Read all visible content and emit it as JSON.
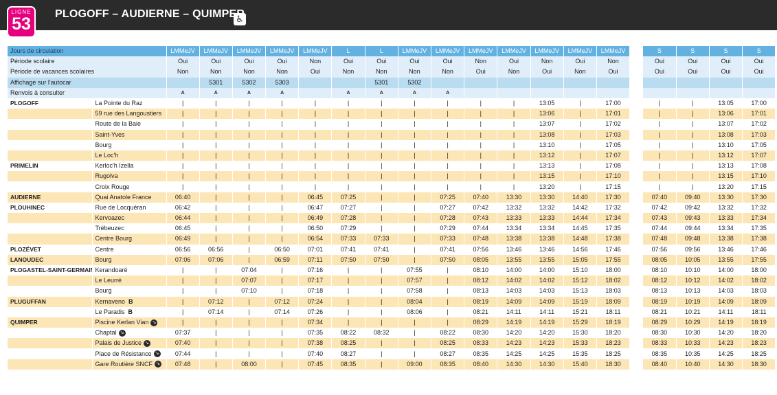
{
  "header": {
    "badge_label": "LIGNE",
    "badge_number": "53",
    "title": "PLOGOFF – AUDIERNE – QUIMPER",
    "accessibility_icon": "wheelchair-icon"
  },
  "colors": {
    "accent": "#e6007e",
    "header_blue": "#62b1e1",
    "light_blue": "#dfeef8",
    "mid_blue": "#b9dcf1",
    "row_alt": "#fde6b6",
    "topbar": "#2b2b2b"
  },
  "left": {
    "header_rows": [
      {
        "label": "Jours de circulation",
        "cells": [
          "LMMeJV",
          "LMMeJV",
          "LMMeJV",
          "LMMeJV",
          "LMMeJV",
          "L",
          "L",
          "LMMeJV",
          "LMMeJV",
          "LMMeJV",
          "LMMeJV",
          "LMMeJV",
          "LMMeJV",
          "LMMeJV"
        ]
      },
      {
        "label": "Période scolaire",
        "cells": [
          "Oui",
          "Oui",
          "Oui",
          "Oui",
          "Non",
          "Oui",
          "Oui",
          "Oui",
          "Oui",
          "Non",
          "Oui",
          "Non",
          "Oui",
          "Non"
        ]
      },
      {
        "label": "Période de vacances scolaires",
        "cells": [
          "Non",
          "Non",
          "Non",
          "Non",
          "Oui",
          "Non",
          "Non",
          "Non",
          "Non",
          "Oui",
          "Non",
          "Oui",
          "Non",
          "Oui"
        ]
      },
      {
        "label": "Affichage sur l'autocar",
        "cells": [
          "",
          "5301",
          "5302",
          "5303",
          "",
          "",
          "5301",
          "5302",
          "",
          "",
          "",
          "",
          "",
          ""
        ]
      },
      {
        "label": "Renvois à consulter",
        "cells": [
          "A",
          "A",
          "A",
          "A",
          "",
          "A",
          "A",
          "A",
          "A",
          "",
          "",
          "",
          "",
          ""
        ]
      }
    ],
    "rows": [
      {
        "town": "PLOGOFF",
        "stop": "La Pointe du Raz",
        "dir": false,
        "b": false,
        "t": [
          "|",
          "|",
          "|",
          "|",
          "|",
          "|",
          "|",
          "|",
          "|",
          "|",
          "|",
          "13:05",
          "|",
          "17:00"
        ]
      },
      {
        "town": "",
        "stop": "59 rue des Langoustiers",
        "dir": false,
        "b": false,
        "t": [
          "|",
          "|",
          "|",
          "|",
          "|",
          "|",
          "|",
          "|",
          "|",
          "|",
          "|",
          "13:06",
          "|",
          "17:01"
        ]
      },
      {
        "town": "",
        "stop": "Route de la Baie",
        "dir": false,
        "b": false,
        "t": [
          "|",
          "|",
          "|",
          "|",
          "|",
          "|",
          "|",
          "|",
          "|",
          "|",
          "|",
          "13:07",
          "|",
          "17:02"
        ]
      },
      {
        "town": "",
        "stop": "Saint-Yves",
        "dir": false,
        "b": false,
        "t": [
          "|",
          "|",
          "|",
          "|",
          "|",
          "|",
          "|",
          "|",
          "|",
          "|",
          "|",
          "13:08",
          "|",
          "17:03"
        ]
      },
      {
        "town": "",
        "stop": "Bourg",
        "dir": false,
        "b": false,
        "t": [
          "|",
          "|",
          "|",
          "|",
          "|",
          "|",
          "|",
          "|",
          "|",
          "|",
          "|",
          "13:10",
          "|",
          "17:05"
        ]
      },
      {
        "town": "",
        "stop": "Le Loc'h",
        "dir": false,
        "b": false,
        "t": [
          "|",
          "|",
          "|",
          "|",
          "|",
          "|",
          "|",
          "|",
          "|",
          "|",
          "|",
          "13:12",
          "|",
          "17:07"
        ]
      },
      {
        "town": "PRIMELIN",
        "stop": "Kerloc'h Izella",
        "dir": false,
        "b": false,
        "t": [
          "|",
          "|",
          "|",
          "|",
          "|",
          "|",
          "|",
          "|",
          "|",
          "|",
          "|",
          "13:13",
          "|",
          "17:08"
        ]
      },
      {
        "town": "",
        "stop": "Rugolva",
        "dir": false,
        "b": false,
        "t": [
          "|",
          "|",
          "|",
          "|",
          "|",
          "|",
          "|",
          "|",
          "|",
          "|",
          "|",
          "13:15",
          "|",
          "17:10"
        ]
      },
      {
        "town": "",
        "stop": "Croix Rouge",
        "dir": false,
        "b": false,
        "t": [
          "|",
          "|",
          "|",
          "|",
          "|",
          "|",
          "|",
          "|",
          "|",
          "|",
          "|",
          "13:20",
          "|",
          "17:15"
        ]
      },
      {
        "town": "AUDIERNE",
        "stop": "Quai Anatole France",
        "dir": false,
        "b": false,
        "t": [
          "06:40",
          "|",
          "|",
          "|",
          "06:45",
          "07:25",
          "|",
          "|",
          "07:25",
          "07:40",
          "13:30",
          "13:30",
          "14:40",
          "17:30"
        ]
      },
      {
        "town": "PLOUHINEC",
        "stop": "Rue de Locquéran",
        "dir": false,
        "b": false,
        "t": [
          "06:42",
          "|",
          "|",
          "|",
          "06:47",
          "07:27",
          "|",
          "|",
          "07:27",
          "07:42",
          "13:32",
          "13:32",
          "14:42",
          "17:32"
        ]
      },
      {
        "town": "",
        "stop": "Kervoazec",
        "dir": false,
        "b": false,
        "t": [
          "06:44",
          "|",
          "|",
          "|",
          "06:49",
          "07:28",
          "|",
          "|",
          "07:28",
          "07:43",
          "13:33",
          "13:33",
          "14:44",
          "17:34"
        ]
      },
      {
        "town": "",
        "stop": "Trébeuzec",
        "dir": false,
        "b": false,
        "t": [
          "06:45",
          "|",
          "|",
          "|",
          "06:50",
          "07:29",
          "|",
          "|",
          "07:29",
          "07:44",
          "13:34",
          "13:34",
          "14:45",
          "17:35"
        ]
      },
      {
        "town": "",
        "stop": "Centre Bourg",
        "dir": false,
        "b": false,
        "t": [
          "06:49",
          "|",
          "|",
          "|",
          "06:54",
          "07:33",
          "07:33",
          "|",
          "07:33",
          "07:48",
          "13:38",
          "13:38",
          "14:48",
          "17:38"
        ]
      },
      {
        "town": "PLOZÉVET",
        "stop": "Centre",
        "dir": false,
        "b": false,
        "t": [
          "06:56",
          "06:56",
          "|",
          "06:50",
          "07:01",
          "07:41",
          "07:41",
          "|",
          "07:41",
          "07:56",
          "13:46",
          "13:46",
          "14:56",
          "17:46"
        ]
      },
      {
        "town": "LANOUDEC",
        "stop": "Bourg",
        "dir": false,
        "b": false,
        "t": [
          "07:06",
          "07:06",
          "|",
          "06:59",
          "07:11",
          "07:50",
          "07:50",
          "|",
          "07:50",
          "08:05",
          "13:55",
          "13:55",
          "15:05",
          "17:55"
        ]
      },
      {
        "town": "PLOGASTEL-SAINT-GERMAIN",
        "stop": "Kerandoaré",
        "dir": false,
        "b": false,
        "t": [
          "|",
          "|",
          "07:04",
          "|",
          "07:16",
          "|",
          "|",
          "07:55",
          "|",
          "08:10",
          "14:00",
          "14:00",
          "15:10",
          "18:00"
        ]
      },
      {
        "town": "",
        "stop": "Le Leurré",
        "dir": false,
        "b": false,
        "t": [
          "|",
          "|",
          "07:07",
          "|",
          "07:17",
          "|",
          "|",
          "07:57",
          "|",
          "08:12",
          "14:02",
          "14:02",
          "15:12",
          "18:02"
        ]
      },
      {
        "town": "",
        "stop": "Bourg",
        "dir": false,
        "b": false,
        "t": [
          "|",
          "|",
          "07:10",
          "|",
          "07:18",
          "|",
          "|",
          "07:58",
          "|",
          "08:13",
          "14:03",
          "14:03",
          "15:13",
          "18:03"
        ]
      },
      {
        "town": "PLUGUFFAN",
        "stop": "Kernaveno",
        "dir": false,
        "b": true,
        "t": [
          "|",
          "07:12",
          "|",
          "07:12",
          "07:24",
          "|",
          "|",
          "08:04",
          "|",
          "08:19",
          "14:09",
          "14:09",
          "15:19",
          "18:09"
        ]
      },
      {
        "town": "",
        "stop": "Le Paradis",
        "dir": false,
        "b": true,
        "t": [
          "|",
          "07:14",
          "|",
          "07:14",
          "07:26",
          "|",
          "|",
          "08:06",
          "|",
          "08:21",
          "14:11",
          "14:11",
          "15:21",
          "18:11"
        ]
      },
      {
        "town": "QUIMPER",
        "stop": "Piscine Kerlan Vian",
        "dir": true,
        "b": false,
        "t": [
          "|",
          "|",
          "|",
          "|",
          "07:34",
          "|",
          "|",
          "|",
          "|",
          "08:29",
          "14:19",
          "14:19",
          "15:29",
          "18:19"
        ]
      },
      {
        "town": "",
        "stop": "Chaptal",
        "dir": true,
        "b": false,
        "t": [
          "07:37",
          "|",
          "|",
          "|",
          "07:35",
          "08:22",
          "08:32",
          "|",
          "08:22",
          "08:30",
          "14:20",
          "14:20",
          "15:30",
          "18:20"
        ]
      },
      {
        "town": "",
        "stop": "Palais de Justice",
        "dir": true,
        "b": false,
        "t": [
          "07:40",
          "|",
          "|",
          "|",
          "07:38",
          "08:25",
          "|",
          "|",
          "08:25",
          "08:33",
          "14:23",
          "14:23",
          "15:33",
          "18:23"
        ]
      },
      {
        "town": "",
        "stop": "Place de Résistance",
        "dir": true,
        "b": false,
        "t": [
          "07:44",
          "|",
          "|",
          "|",
          "07:40",
          "08:27",
          "|",
          "|",
          "08:27",
          "08:35",
          "14:25",
          "14:25",
          "15:35",
          "18:25"
        ]
      },
      {
        "town": "",
        "stop": "Gare Routière SNCF",
        "dir": true,
        "b": false,
        "t": [
          "07:48",
          "|",
          "08:00",
          "|",
          "07:45",
          "08:35",
          "|",
          "09:00",
          "08:35",
          "08:40",
          "14:30",
          "14:30",
          "15:40",
          "18:30"
        ]
      }
    ],
    "b_mark": "B"
  },
  "right": {
    "header_rows": [
      {
        "cells": [
          "S",
          "S",
          "S",
          "S"
        ]
      },
      {
        "cells": [
          "Oui",
          "Oui",
          "Oui",
          "Oui"
        ]
      },
      {
        "cells": [
          "Oui",
          "Oui",
          "Oui",
          "Oui"
        ]
      },
      {
        "cells": [
          "",
          "",
          "",
          ""
        ]
      },
      {
        "cells": [
          "",
          "",
          "",
          ""
        ]
      }
    ],
    "rows": [
      [
        "|",
        "|",
        "13:05",
        "17:00"
      ],
      [
        "|",
        "|",
        "13:06",
        "17:01"
      ],
      [
        "|",
        "|",
        "13:07",
        "17:02"
      ],
      [
        "|",
        "|",
        "13:08",
        "17:03"
      ],
      [
        "|",
        "|",
        "13:10",
        "17:05"
      ],
      [
        "|",
        "|",
        "13:12",
        "17:07"
      ],
      [
        "|",
        "|",
        "13:13",
        "17:08"
      ],
      [
        "|",
        "|",
        "13:15",
        "17:10"
      ],
      [
        "|",
        "|",
        "13:20",
        "17:15"
      ],
      [
        "07:40",
        "09:40",
        "13:30",
        "17:30"
      ],
      [
        "07:42",
        "09:42",
        "13:32",
        "17:32"
      ],
      [
        "07:43",
        "09:43",
        "13:33",
        "17:34"
      ],
      [
        "07:44",
        "09:44",
        "13:34",
        "17:35"
      ],
      [
        "07:48",
        "09:48",
        "13:38",
        "17:38"
      ],
      [
        "07:56",
        "09:56",
        "13:46",
        "17:46"
      ],
      [
        "08:05",
        "10:05",
        "13:55",
        "17:55"
      ],
      [
        "08:10",
        "10:10",
        "14:00",
        "18:00"
      ],
      [
        "08:12",
        "10:12",
        "14:02",
        "18:02"
      ],
      [
        "08:13",
        "10:13",
        "14:03",
        "18:03"
      ],
      [
        "08:19",
        "10:19",
        "14:09",
        "18:09"
      ],
      [
        "08:21",
        "10:21",
        "14:11",
        "18:11"
      ],
      [
        "08:29",
        "10:29",
        "14:19",
        "18:19"
      ],
      [
        "08:30",
        "10:30",
        "14:20",
        "18:20"
      ],
      [
        "08:33",
        "10:33",
        "14:23",
        "18:23"
      ],
      [
        "08:35",
        "10:35",
        "14:25",
        "18:25"
      ],
      [
        "08:40",
        "10:40",
        "14:30",
        "18:30"
      ]
    ]
  }
}
